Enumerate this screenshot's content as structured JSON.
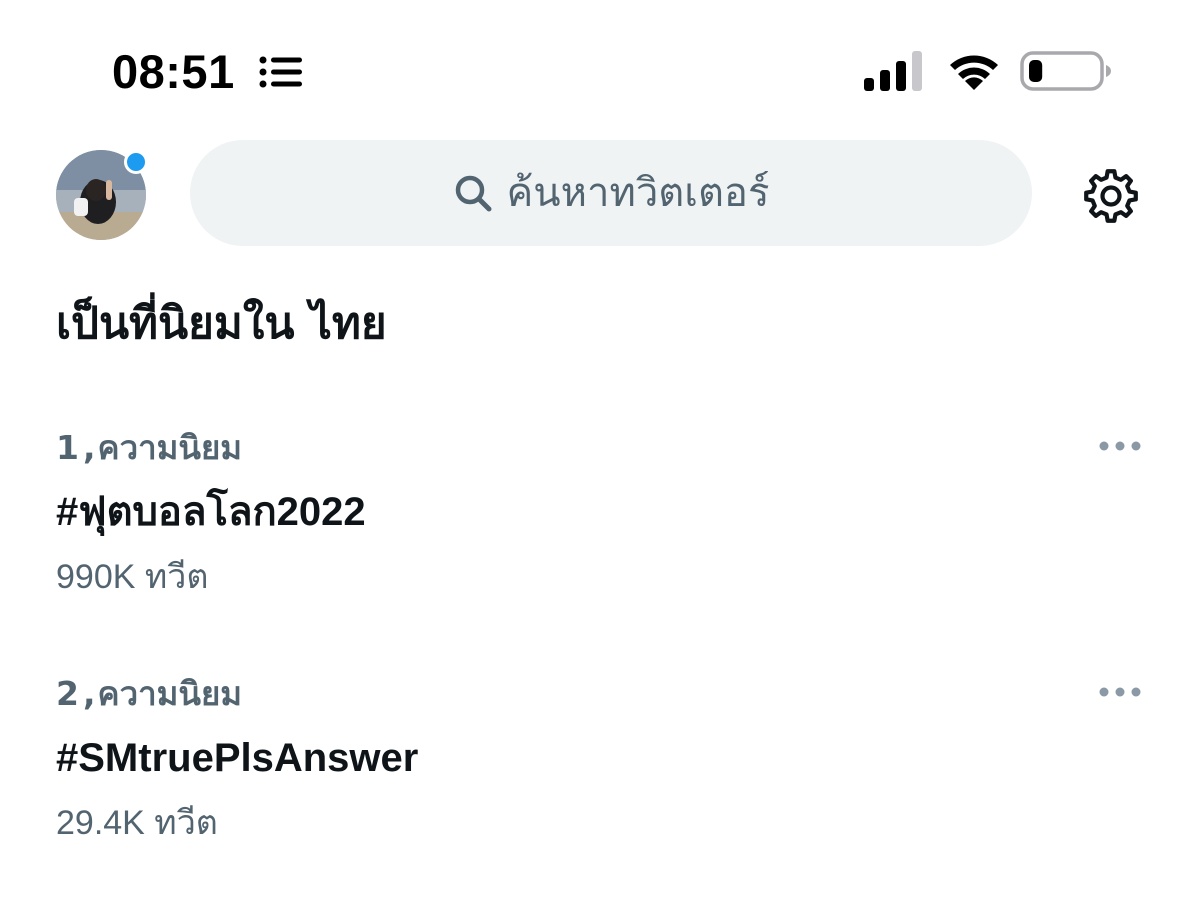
{
  "status_bar": {
    "time": "08:51",
    "icons": [
      "list-icon",
      "cellular-signal-icon",
      "wifi-icon",
      "battery-icon"
    ],
    "battery_level": 0.2
  },
  "header": {
    "avatar_icon": "user-avatar",
    "search": {
      "placeholder": "ค้นหาทวิตเตอร์",
      "icon": "search-icon"
    },
    "settings_icon": "gear-icon"
  },
  "section": {
    "title": "เป็นที่นิยมใน ไทย"
  },
  "trends": [
    {
      "rank": "1",
      "separator": ",",
      "category": "ความนิยม",
      "name": "#ฟุตบอลโลก2022",
      "count": "990K ทวีต"
    },
    {
      "rank": "2",
      "separator": ",",
      "category": "ความนิยม",
      "name": "#SMtruePlsAnswer",
      "count": "29.4K ทวีต"
    }
  ],
  "colors": {
    "accent": "#1d9bf0",
    "text_primary": "#0f1419",
    "text_secondary": "#536471",
    "search_bg": "#eff3f4"
  }
}
